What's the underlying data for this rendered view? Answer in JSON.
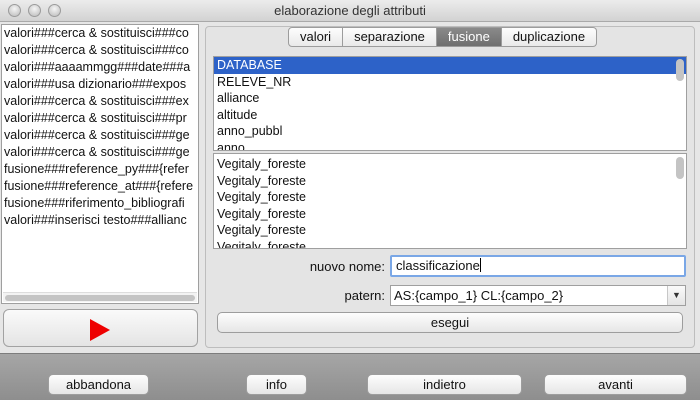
{
  "window": {
    "title": "elaborazione degli attributi"
  },
  "history_list": [
    "valori###cerca & sostituisci###co",
    "valori###cerca & sostituisci###co",
    "valori###aaaammgg###date###a",
    "valori###usa dizionario###expos",
    "valori###cerca & sostituisci###ex",
    "valori###cerca & sostituisci###pr",
    "valori###cerca & sostituisci###ge",
    "valori###cerca & sostituisci###ge",
    "fusione###reference_py###{refer",
    "fusione###reference_at###{refere",
    "fusione###riferimento_bibliografi",
    "valori###inserisci testo###allianc"
  ],
  "tabs": [
    {
      "label": "valori",
      "active": false
    },
    {
      "label": "separazione",
      "active": false
    },
    {
      "label": "fusione",
      "active": true
    },
    {
      "label": "duplicazione",
      "active": false
    }
  ],
  "fields_list": [
    "DATABASE",
    "RELEVE_NR",
    "alliance",
    "altitude",
    "anno_pubbl",
    "anno_..."
  ],
  "fields_selected_index": 0,
  "values_list": [
    "Vegitaly_foreste",
    "Vegitaly_foreste",
    "Vegitaly_foreste",
    "Vegitaly_foreste",
    "Vegitaly_foreste",
    "Vegitaly_foreste"
  ],
  "form": {
    "new_name_label": "nuovo nome:",
    "new_name_value": "classificazione",
    "pattern_label": "patern:",
    "pattern_value": "AS:{campo_1} CL:{campo_2}"
  },
  "buttons": {
    "run": "esegui",
    "abandon": "abbandona",
    "info": "info",
    "back": "indietro",
    "next": "avanti"
  },
  "colors": {
    "selection": "#2d62c8",
    "play": "#ee0000",
    "active_tab": "#7a7a7a"
  }
}
